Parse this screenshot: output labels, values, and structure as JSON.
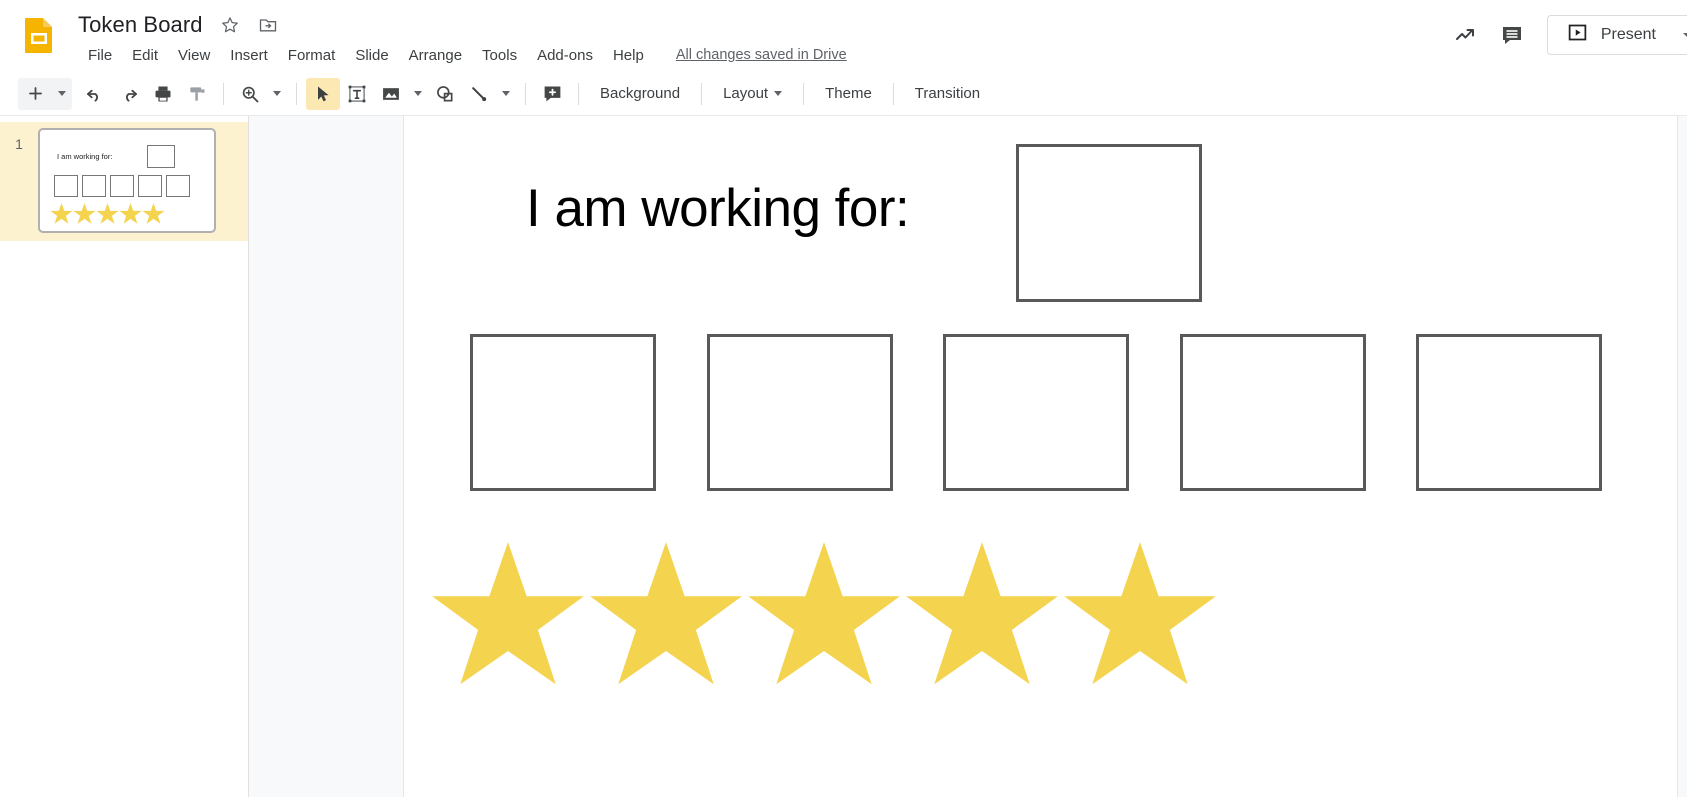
{
  "app": {
    "name": "Google Slides",
    "logo_icon": "slides-logo-icon"
  },
  "header": {
    "doc_title": "Token Board",
    "star_icon": "star-outline-icon",
    "move_icon": "move-to-folder-icon",
    "save_state": "All changes saved in Drive",
    "menus": [
      "File",
      "Edit",
      "View",
      "Insert",
      "Format",
      "Slide",
      "Arrange",
      "Tools",
      "Add-ons",
      "Help"
    ],
    "activity_icon": "activity-trend-icon",
    "comments_icon": "comment-icon",
    "present": {
      "label": "Present",
      "icon": "present-play-icon",
      "caret_icon": "chevron-down-icon"
    }
  },
  "toolbar": {
    "new_slide": {
      "icon": "plus-icon",
      "caret_icon": "chevron-down-icon"
    },
    "undo": {
      "icon": "undo-icon"
    },
    "redo": {
      "icon": "redo-icon"
    },
    "print": {
      "icon": "print-icon"
    },
    "paint_format": {
      "icon": "paint-format-icon"
    },
    "zoom": {
      "icon": "zoom-in-icon",
      "caret_icon": "chevron-down-icon"
    },
    "select": {
      "icon": "cursor-arrow-icon",
      "active": true
    },
    "textbox": {
      "icon": "text-box-icon"
    },
    "image": {
      "icon": "image-icon",
      "caret_icon": "chevron-down-icon"
    },
    "shape": {
      "icon": "shape-icon"
    },
    "line": {
      "icon": "line-icon",
      "caret_icon": "chevron-down-icon"
    },
    "comment": {
      "icon": "add-comment-icon"
    },
    "background_label": "Background",
    "layout_label": "Layout",
    "layout_caret_icon": "chevron-down-icon",
    "theme_label": "Theme",
    "transition_label": "Transition"
  },
  "filmstrip": {
    "slides": [
      {
        "number": "1",
        "selected": true,
        "title_text": "I am working for:",
        "token_box_count": 5,
        "star_count": 5
      }
    ]
  },
  "slide": {
    "title_text": "I am working for:",
    "reward_box": {
      "name": "reward-box",
      "filled": false
    },
    "token_boxes": [
      {
        "index": 1,
        "filled": false
      },
      {
        "index": 2,
        "filled": false
      },
      {
        "index": 3,
        "filled": false
      },
      {
        "index": 4,
        "filled": false
      },
      {
        "index": 5,
        "filled": false
      }
    ],
    "stars": [
      {
        "index": 1
      },
      {
        "index": 2
      },
      {
        "index": 3
      },
      {
        "index": 4
      },
      {
        "index": 5
      }
    ]
  },
  "colors": {
    "star_yellow": "#F4D34E",
    "box_border": "#595959",
    "logo_yellow": "#F4B400",
    "selected_slide_bg": "#FDF2D0",
    "toolbar_active": "#FCE8B2",
    "canvas_gutter": "#F8F9FA",
    "text_primary": "#202124",
    "text_secondary": "#5F6368"
  }
}
